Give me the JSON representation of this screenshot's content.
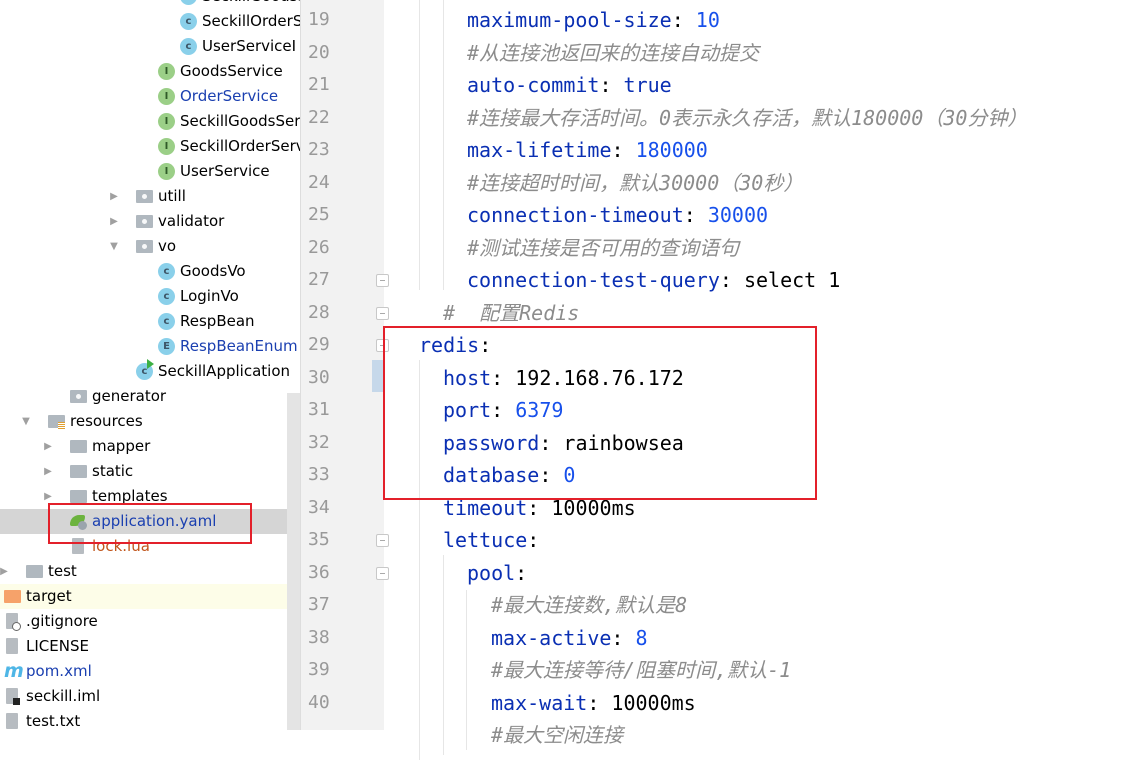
{
  "project_tree": [
    {
      "label": "SeckillGoodsS",
      "icon": "class-icon",
      "level": 8,
      "color": "default"
    },
    {
      "label": "SeckillOrderS",
      "icon": "class-icon",
      "level": 8,
      "color": "default"
    },
    {
      "label": "UserServiceI",
      "icon": "class-icon",
      "level": 8,
      "color": "default"
    },
    {
      "label": "GoodsService",
      "icon": "interface-icon",
      "level": 7,
      "color": "default"
    },
    {
      "label": "OrderService",
      "icon": "interface-icon",
      "level": 7,
      "color": "blue"
    },
    {
      "label": "SeckillGoodsSer",
      "icon": "interface-icon",
      "level": 7,
      "color": "default"
    },
    {
      "label": "SeckillOrderServ",
      "icon": "interface-icon",
      "level": 7,
      "color": "default"
    },
    {
      "label": "UserService",
      "icon": "interface-icon",
      "level": 7,
      "color": "default"
    },
    {
      "label": "utill",
      "icon": "package-folder-icon",
      "level": 6,
      "expand": "collapsed"
    },
    {
      "label": "validator",
      "icon": "package-folder-icon",
      "level": 6,
      "expand": "collapsed"
    },
    {
      "label": "vo",
      "icon": "package-folder-icon",
      "level": 6,
      "expand": "expanded"
    },
    {
      "label": "GoodsVo",
      "icon": "class-icon",
      "level": 7,
      "color": "default"
    },
    {
      "label": "LoginVo",
      "icon": "class-icon",
      "level": 7,
      "color": "default"
    },
    {
      "label": "RespBean",
      "icon": "class-icon",
      "level": 7,
      "color": "default"
    },
    {
      "label": "RespBeanEnum",
      "icon": "enum-icon",
      "level": 7,
      "color": "blue"
    },
    {
      "label": "SeckillApplication",
      "icon": "spring-boot-class-icon",
      "level": 6,
      "color": "default"
    },
    {
      "label": "generator",
      "icon": "package-folder-icon",
      "level": 3,
      "color": "default"
    },
    {
      "label": "resources",
      "icon": "resources-folder-icon",
      "level": 2,
      "expand": "expanded"
    },
    {
      "label": "mapper",
      "icon": "folder-icon",
      "level": 3,
      "expand": "collapsed"
    },
    {
      "label": "static",
      "icon": "folder-icon",
      "level": 3,
      "expand": "collapsed"
    },
    {
      "label": "templates",
      "icon": "folder-icon",
      "level": 3,
      "expand": "collapsed"
    },
    {
      "label": "application.yaml",
      "icon": "spring-yaml-icon",
      "level": 3,
      "color": "blue",
      "selected": true
    },
    {
      "label": "lock.lua",
      "icon": "text-file-icon",
      "level": 3,
      "color": "orange"
    },
    {
      "label": "test",
      "icon": "folder-icon",
      "level": 1,
      "expand": "collapsed"
    },
    {
      "label": "target",
      "icon": "excluded-folder-icon",
      "level": 0,
      "highlight": true
    },
    {
      "label": ".gitignore",
      "icon": "ignore-file-icon",
      "level": 0
    },
    {
      "label": "LICENSE",
      "icon": "text-file-icon",
      "level": 0
    },
    {
      "label": "pom.xml",
      "icon": "maven-icon",
      "level": 0,
      "color": "blue"
    },
    {
      "label": "seckill.iml",
      "icon": "iml-file-icon",
      "level": 0
    },
    {
      "label": "test.txt",
      "icon": "text-file-icon",
      "level": 0
    }
  ],
  "editor": {
    "lines": [
      {
        "n": "19",
        "indent": 2,
        "key": "maximum-pool-size",
        "value": "10",
        "vtype": "num"
      },
      {
        "n": "20",
        "indent": 2,
        "comment": "#从连接池返回来的连接自动提交"
      },
      {
        "n": "21",
        "indent": 2,
        "key": "auto-commit",
        "value": "true",
        "vtype": "kw"
      },
      {
        "n": "22",
        "indent": 2,
        "comment": "#连接最大存活时间。0表示永久存活，默认180000（30分钟）"
      },
      {
        "n": "23",
        "indent": 2,
        "key": "max-lifetime",
        "value": "180000",
        "vtype": "num"
      },
      {
        "n": "24",
        "indent": 2,
        "comment": "#连接超时时间，默认30000（30秒）"
      },
      {
        "n": "25",
        "indent": 2,
        "key": "connection-timeout",
        "value": "30000",
        "vtype": "num"
      },
      {
        "n": "26",
        "indent": 2,
        "comment": "#测试连接是否可用的查询语句"
      },
      {
        "n": "27",
        "indent": 2,
        "key": "connection-test-query",
        "value": "select 1",
        "vtype": "str",
        "fold": true
      },
      {
        "n": "28",
        "indent": 1,
        "comment": "#  配置Redis",
        "fold": true
      },
      {
        "n": "29",
        "indent": 0,
        "key": "redis",
        "fold": true
      },
      {
        "n": "30",
        "indent": 1,
        "key": "host",
        "value": "192.168.76.172",
        "vtype": "str"
      },
      {
        "n": "31",
        "indent": 1,
        "key": "port",
        "value": "6379",
        "vtype": "num"
      },
      {
        "n": "32",
        "indent": 1,
        "key": "password",
        "value": "rainbowsea",
        "vtype": "str"
      },
      {
        "n": "33",
        "indent": 1,
        "key": "database",
        "value": "0",
        "vtype": "num"
      },
      {
        "n": "34",
        "indent": 1,
        "key": "timeout",
        "value": "10000ms",
        "vtype": "str"
      },
      {
        "n": "35",
        "indent": 1,
        "key": "lettuce",
        "fold": true
      },
      {
        "n": "36",
        "indent": 2,
        "key": "pool",
        "fold": true
      },
      {
        "n": "37",
        "indent": 3,
        "comment": "#最大连接数,默认是8"
      },
      {
        "n": "38",
        "indent": 3,
        "key": "max-active",
        "value": "8",
        "vtype": "num"
      },
      {
        "n": "39",
        "indent": 3,
        "comment": "#最大连接等待/阻塞时间,默认-1"
      },
      {
        "n": "40",
        "indent": 3,
        "key": "max-wait",
        "value": "10000ms",
        "vtype": "str"
      },
      {
        "n": "",
        "indent": 3,
        "comment": "#最大空闲连接"
      }
    ]
  },
  "colors": {
    "annotation_box": "#e3202a",
    "key": "#0a2fb3",
    "number": "#1750eb",
    "comment": "#8c8c8c"
  }
}
